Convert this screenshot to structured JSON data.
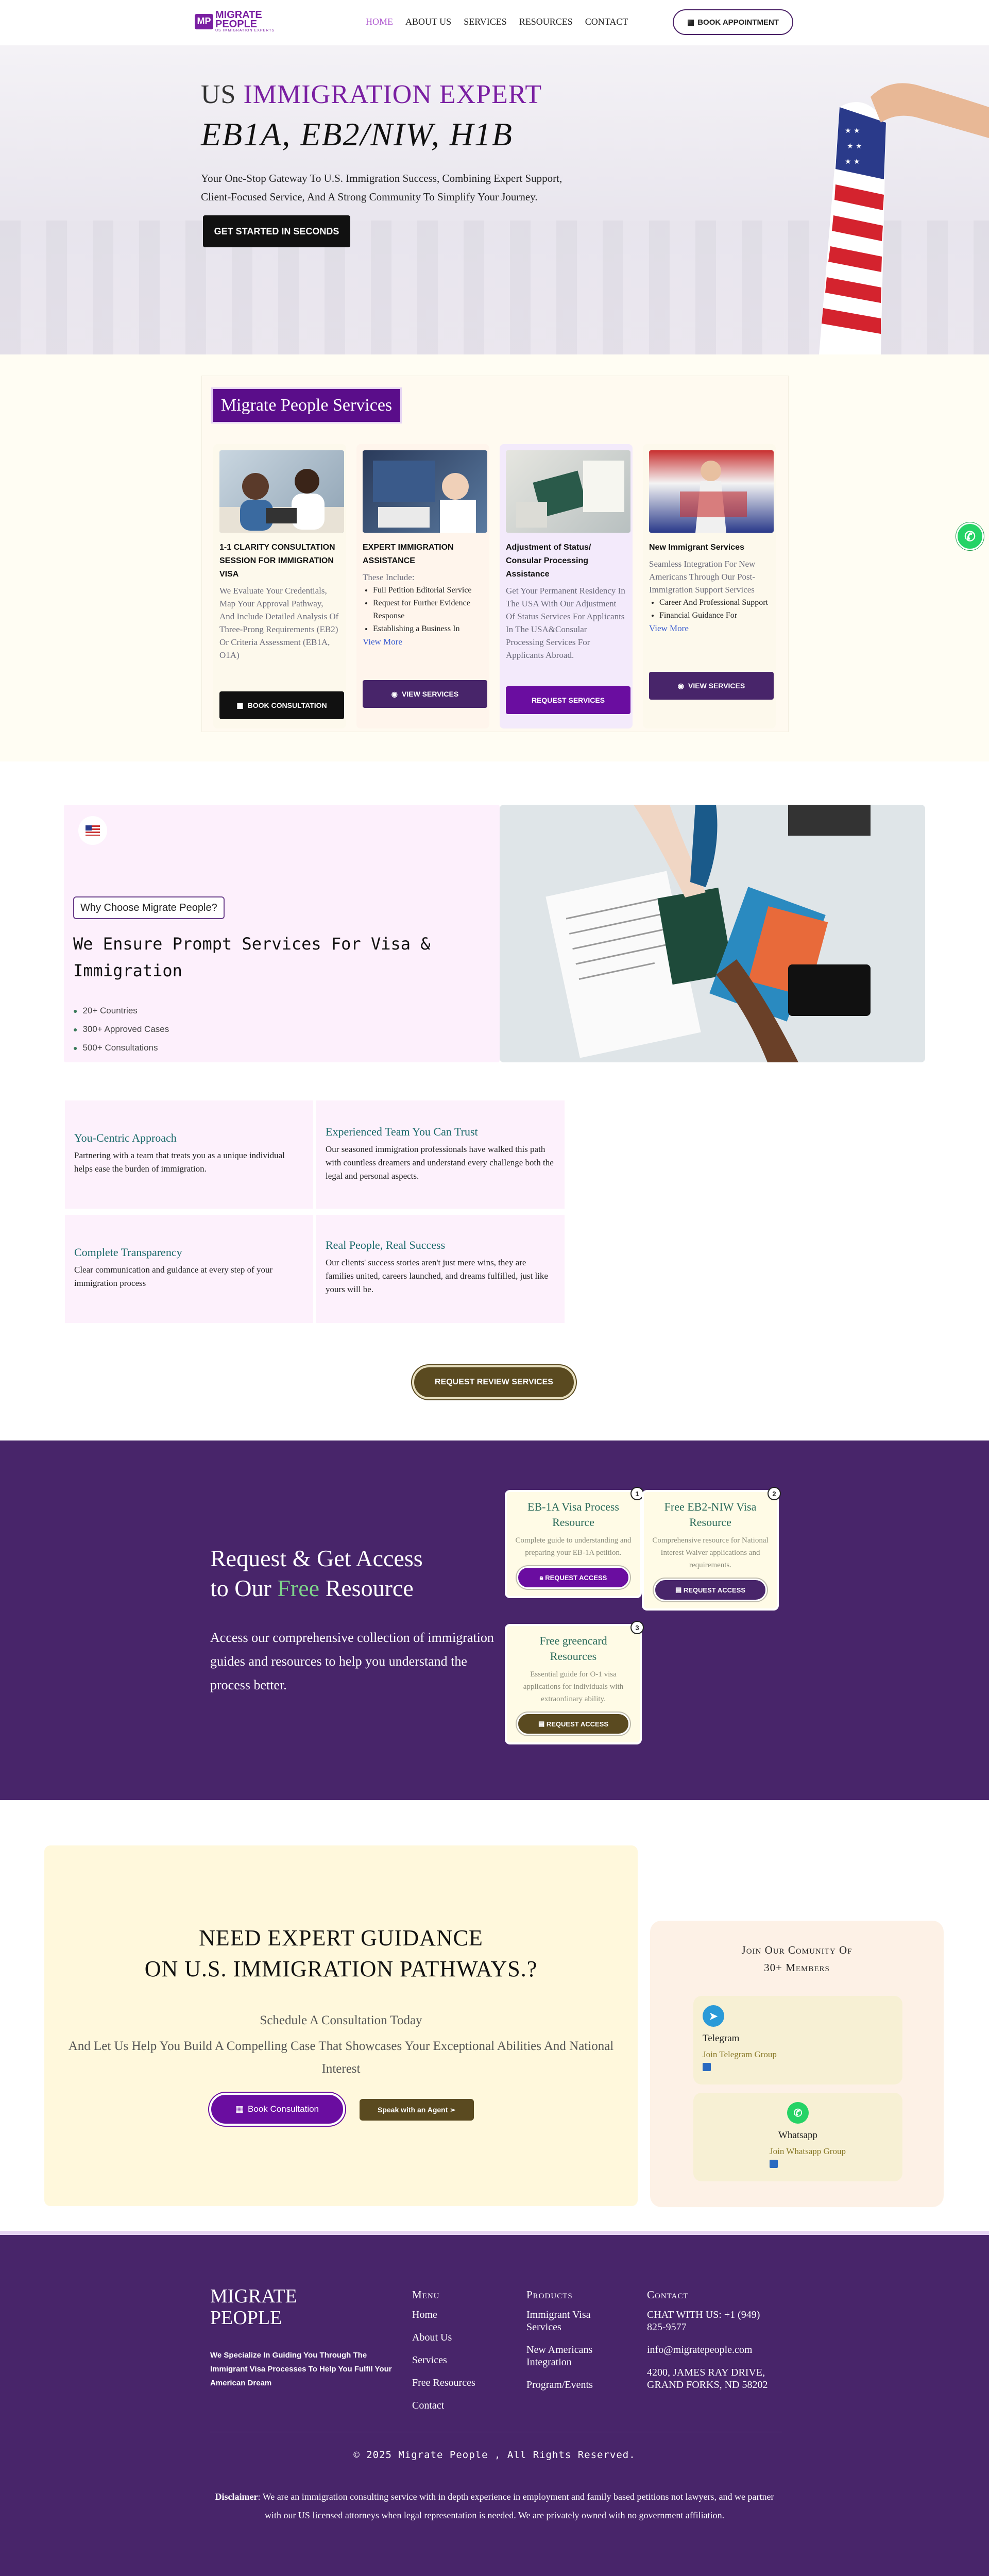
{
  "nav": {
    "logo_mark": "MP",
    "logo_line1": "MIGRATE",
    "logo_line2": "PEOPLE",
    "logo_tagline": "US IMMIGRATION EXPERTS",
    "links": [
      "HOME",
      "ABOUT US",
      "SERVICES",
      "RESOURCES",
      "CONTACT"
    ],
    "active_link": "HOME",
    "book_label": "BOOK APPOINTMENT"
  },
  "hero": {
    "title_prefix": "US",
    "title_highlight": "IMMIGRATION EXPERT",
    "subtitle": "EB1A, EB2/NIW, H1B",
    "description": "Your One-Stop Gateway To U.S. Immigration Success, Combining Expert Support, Client-Focused Service, And A Strong Community To Simplify Your Journey.",
    "cta": "GET STARTED IN SECONDS"
  },
  "services": {
    "title": "Migrate People Services",
    "cards": [
      {
        "name": "1-1 CLARITY CONSULTATION SESSION FOR IMMIGRATION VISA",
        "description": "We Evaluate Your Credentials, Map Your Approval Pathway, And Include Detailed Analysis Of Three-Prong Requirements (EB2) Or Criteria Assessment (EB1A, O1A)",
        "button": "BOOK CONSULTATION"
      },
      {
        "name": "EXPERT IMMIGRATION ASSISTANCE",
        "intro": "These Include:",
        "bullets": [
          "Full Petition Editorial Service",
          "Request for Further Evidence Response",
          "Establishing a Business In"
        ],
        "more": "View More",
        "button": "VIEW SERVICES"
      },
      {
        "name": "Adjustment of Status/ Consular Processing Assistance",
        "description": "Get Your Permanent Residency In The USA With Our Adjustment Of Status Services For Applicants In The USA&Consular Processing Services For Applicants Abroad.",
        "button": "REQUEST SERVICES"
      },
      {
        "name": "New Immigrant Services",
        "description": "Seamless Integration For New Americans Through Our Post-Immigration Support Services",
        "bullets": [
          "Career And Professional Support",
          "Financial Guidance For"
        ],
        "more": "View More",
        "button": "VIEW SERVICES"
      }
    ]
  },
  "why": {
    "badge": "Why Choose Migrate People?",
    "title": "We Ensure Prompt Services For Visa & Immigration",
    "stats": [
      "20+ Countries",
      "300+ Approved Cases",
      "500+ Consultations"
    ],
    "features": [
      {
        "title": "You-Centric Approach",
        "text": "Partnering with a team that treats you as a unique individual helps ease the burden of immigration."
      },
      {
        "title": "Experienced Team You Can Trust",
        "text": "Our seasoned immigration professionals have walked this path with countless dreamers and understand every challenge both the legal and personal aspects."
      },
      {
        "title": "Complete Transparency",
        "text": "Clear communication and guidance at every step of your immigration process"
      },
      {
        "title": "Real People, Real Success",
        "text": "Our clients' success stories aren't just mere wins, they are families united, careers launched, and dreams fulfilled, just like yours will be."
      }
    ],
    "review_button": "REQUEST REVIEW SERVICES"
  },
  "resources": {
    "heading_line1": "Request & Get Access",
    "heading_line2_pre": "to Our",
    "heading_free": "Free",
    "heading_line2_post": "Resource",
    "description": "Access our comprehensive collection of immigration guides and resources to help you understand the process better.",
    "cards": [
      {
        "num": "1",
        "title": "EB-1A Visa Process Resource",
        "text": "Complete guide to understanding and preparing your EB-1A petition.",
        "button": "REQUEST ACCESS",
        "color": "#6a0da0"
      },
      {
        "num": "2",
        "title": "Free EB2-NIW Visa Resource",
        "text": "Comprehensive resource for National Interest Waiver applications and requirements.",
        "button": "REQUEST ACCESS",
        "color": "#48256a"
      },
      {
        "num": "3",
        "title": "Free greencard Resources",
        "text": "Essential guide for O-1 visa applications for individuals with extraordinary ability.",
        "button": "REQUEST ACCESS",
        "color": "#5a4a20"
      }
    ]
  },
  "guidance": {
    "heading_line1": "NEED EXPERT GUIDANCE",
    "heading_line2": "ON U.S. IMMIGRATION PATHWAYS.?",
    "sub1": "Schedule A Consultation Today",
    "sub2": "And Let Us Help You Build A Compelling Case That Showcases Your Exceptional Abilities And National Interest",
    "btn_primary": "Book Consultation",
    "btn_secondary": "Speak with an Agent"
  },
  "community": {
    "title_line1": "Join Our Comunity Of",
    "title_line2": "30+ Members",
    "telegram": {
      "name": "Telegram",
      "link": "Join Telegram Group"
    },
    "whatsapp": {
      "name": "Whatsapp",
      "link": "Join Whatsapp Group"
    }
  },
  "footer": {
    "brand_line1": "MIGRATE",
    "brand_line2": "PEOPLE",
    "tagline": "We Specialize In Guiding You Through The Immigrant Visa Processes To Help You Fulfil Your American Dream",
    "menu_title": "Menu",
    "menu": [
      "Home",
      "About Us",
      "Services",
      "Free Resources",
      "Contact"
    ],
    "products_title": "Products",
    "products": [
      "Immigrant Visa Services",
      "New Americans Integration",
      "Program/Events"
    ],
    "contact_title": "Contact",
    "contact": [
      "CHAT WITH US: +1 (949) 825-9577",
      "info@migratepeople.com",
      "4200, JAMES RAY DRIVE, GRAND FORKS, ND 58202"
    ],
    "copyright": "© 2025 Migrate People , All Rights Reserved.",
    "disclaimer_label": "Disclaimer",
    "disclaimer": ": We are an immigration consulting service with in depth experience in employment and family based petitions not lawyers, and we partner with our US licensed attorneys when legal representation is needed. We are privately owned with no government affiliation."
  }
}
